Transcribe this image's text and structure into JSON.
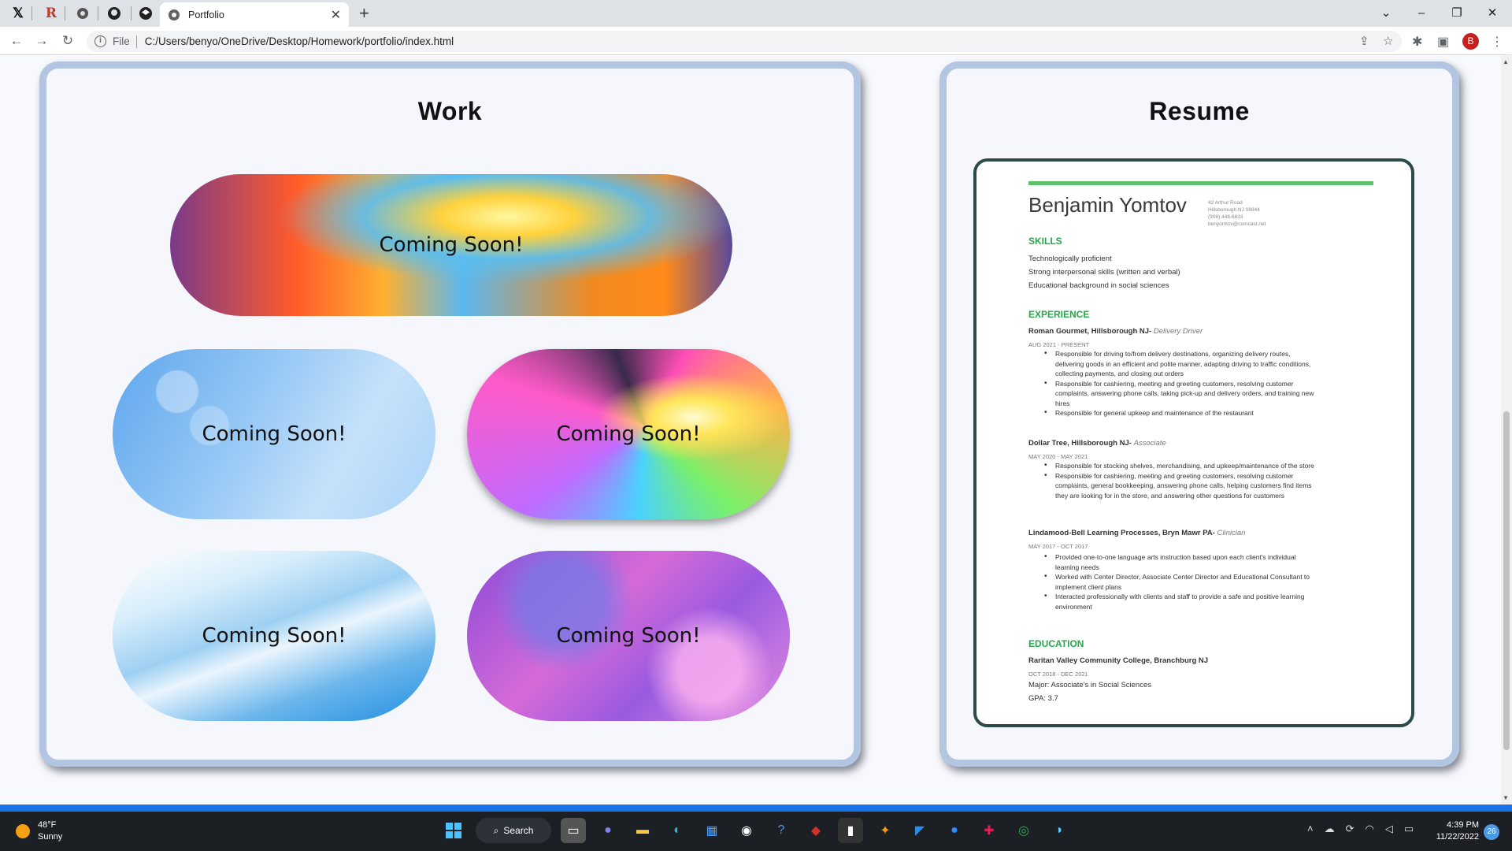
{
  "browser": {
    "tab_title": "Portfolio",
    "address_scheme": "File",
    "address_url": "C:/Users/benyo/OneDrive/Desktop/Homework/portfolio/index.html",
    "profile_initial": "B",
    "pinned_tabs": [
      "x-icon",
      "r-icon",
      "globe-icon",
      "github-icon",
      "codepen-icon"
    ]
  },
  "work": {
    "title": "Work",
    "projects": [
      {
        "label": "Coming Soon!"
      },
      {
        "label": "Coming Soon!"
      },
      {
        "label": "Coming Soon!"
      },
      {
        "label": "Coming Soon!"
      },
      {
        "label": "Coming Soon!"
      }
    ]
  },
  "resume": {
    "title": "Resume",
    "name": "Benjamin Yomtov",
    "contact": [
      "42 Arthur Road",
      "Hillsborough NJ 08844",
      "(908) 448-6633",
      "benyomtov@comcast.net"
    ],
    "skills_heading": "SKILLS",
    "skills": [
      "Technologically proficient",
      "Strong interpersonal skills (written and verbal)",
      "Educational background in social sciences"
    ],
    "experience_heading": "EXPERIENCE",
    "jobs": [
      {
        "employer": "Roman Gourmet,  Hillsborough NJ-",
        "role": "Delivery Driver",
        "dates": "AUG 2021 - PRESENT",
        "bullets": [
          "Responsible for driving to/from delivery destinations, organizing delivery routes, delivering goods in an efficient and polite manner, adapting driving to traffic conditions, collecting payments, and closing out orders",
          "Responsible for cashiering, meeting and greeting customers, resolving customer complaints, answering phone calls, taking pick-up and delivery orders, and training new hires",
          "Responsible for general upkeep and maintenance of the restaurant"
        ]
      },
      {
        "employer": "Dollar Tree,  Hillsborough NJ-",
        "role": "Associate",
        "dates": "MAY 2020 - MAY 2021",
        "bullets": [
          "Responsible for stocking shelves, merchandising, and upkeep/maintenance of the store",
          "Responsible for cashiering, meeting and greeting customers, resolving customer complaints, general bookkeeping, answering phone calls, helping customers find items they are looking for in the store, and answering other questions for customers"
        ]
      },
      {
        "employer": "Lindamood-Bell Learning Processes, Bryn Mawr PA-",
        "role": "Clinician",
        "dates": "MAY 2017 - OCT 2017",
        "bullets": [
          "Provided one-to-one language arts instruction based upon each client's individual learning needs",
          "Worked with Center Director, Associate Center Director and Educational Consultant to implement client plans",
          "Interacted professionally with clients and staff to provide a safe and positive learning environment"
        ]
      }
    ],
    "education_heading": "EDUCATION",
    "school": "Raritan Valley Community College, Branchburg NJ",
    "school_dates": "OCT 2018 - DEC 2021",
    "major": "Major: Associate's in Social Sciences",
    "gpa": "GPA: 3.7"
  },
  "taskbar": {
    "temperature": "48°F",
    "condition": "Sunny",
    "search_label": "Search",
    "time": "4:39 PM",
    "date": "11/22/2022",
    "notification_count": "26"
  }
}
